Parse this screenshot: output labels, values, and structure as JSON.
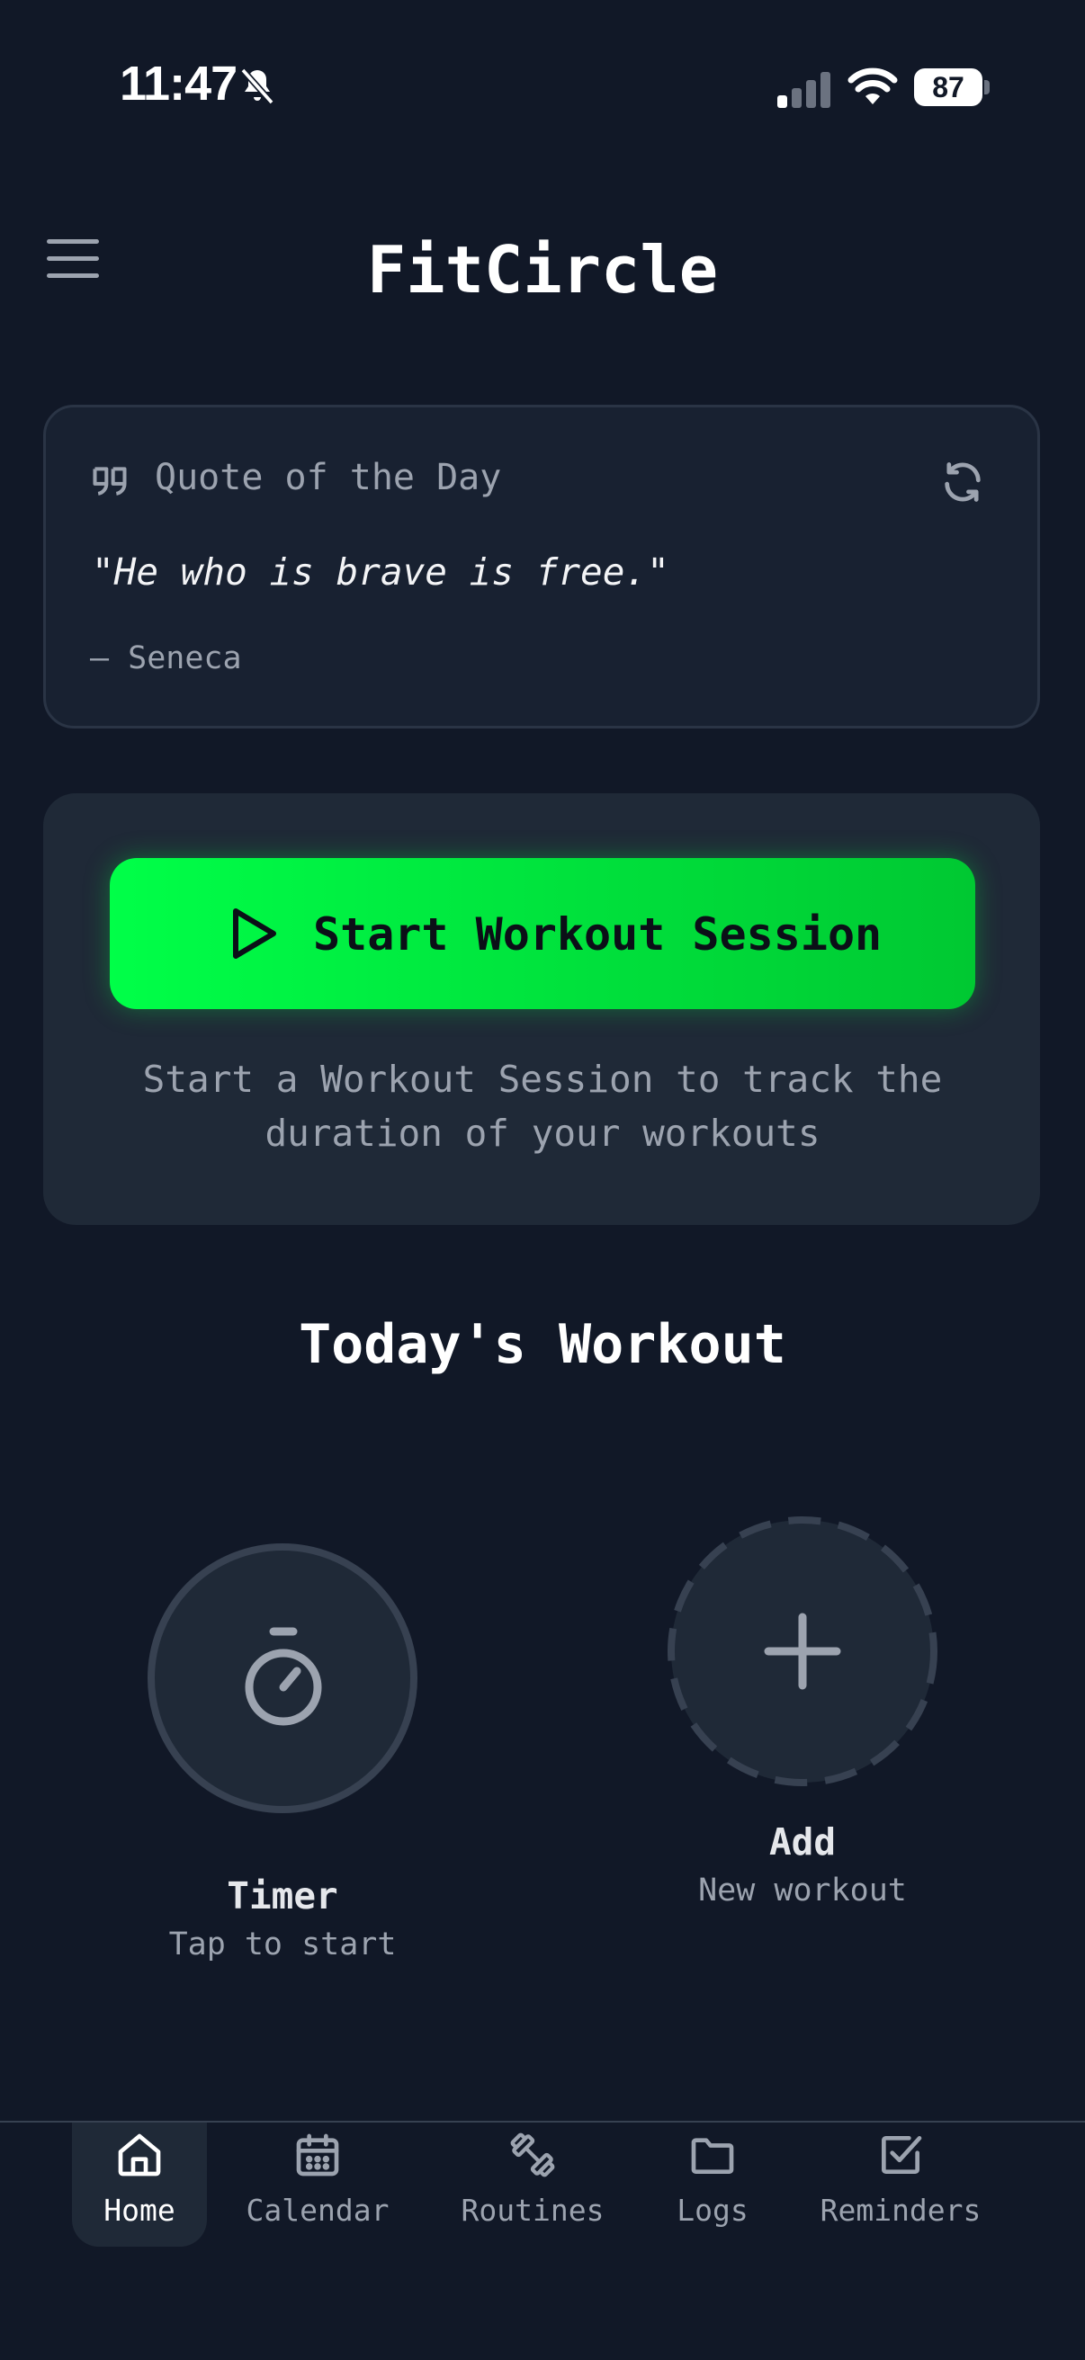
{
  "status_bar": {
    "time": "11:47",
    "battery": "87"
  },
  "header": {
    "title": "FitCircle"
  },
  "quote_card": {
    "heading": "Quote of the Day",
    "quote": "\"He who is brave is free.\"",
    "author": "— Seneca"
  },
  "session": {
    "button_label": "Start Workout Session",
    "description_line1": "Start a Workout Session to track the",
    "description_line2": "duration of your workouts"
  },
  "today": {
    "title": "Today's Workout",
    "timer": {
      "label": "Timer",
      "sublabel": "Tap to start"
    },
    "add": {
      "label": "Add",
      "sublabel": "New workout"
    }
  },
  "nav": {
    "items": [
      {
        "label": "Home",
        "icon": "home-icon",
        "active": true
      },
      {
        "label": "Calendar",
        "icon": "calendar-icon",
        "active": false
      },
      {
        "label": "Routines",
        "icon": "dumbbell-icon",
        "active": false
      },
      {
        "label": "Logs",
        "icon": "folder-icon",
        "active": false
      },
      {
        "label": "Reminders",
        "icon": "checkbox-icon",
        "active": false
      }
    ]
  },
  "colors": {
    "background": "#111827",
    "card": "#1f2937",
    "accent_green": "#00ff48",
    "muted_text": "#9ca3af"
  }
}
